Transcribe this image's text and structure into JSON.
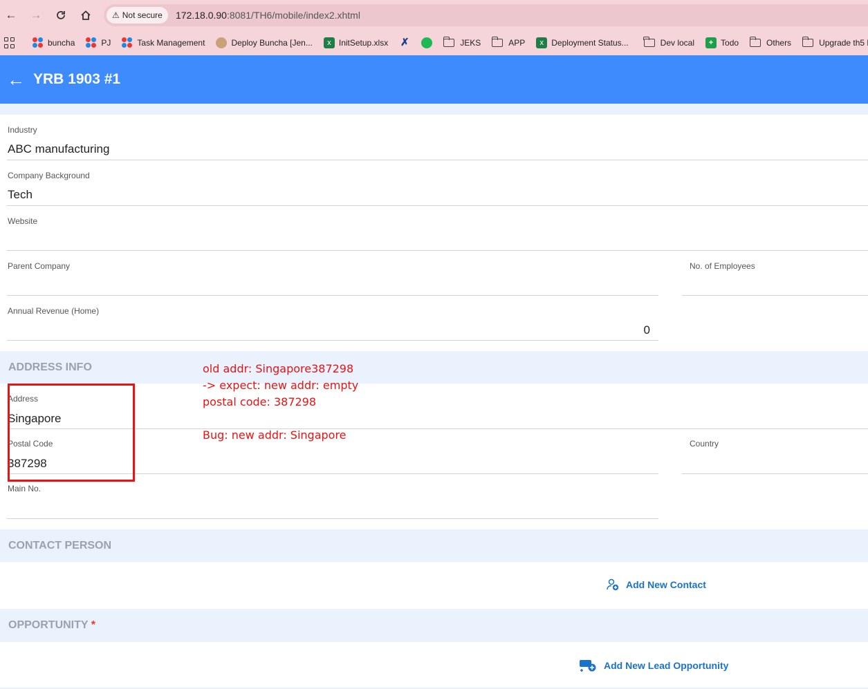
{
  "browser": {
    "security_label": "Not secure",
    "url_host": "172.18.0.90",
    "url_rest": ":8081/TH6/mobile/index2.xhtml",
    "bookmarks": [
      "buncha",
      "PJ",
      "Task Management",
      "Deploy Buncha [Jen...",
      "InitSetup.xlsx",
      "JEKS",
      "APP",
      "Deployment Status...",
      "Dev local",
      "Todo",
      "Others",
      "Upgrade th5 l"
    ]
  },
  "header": {
    "title": "YRB 1903 #1"
  },
  "company": {
    "industry_label": "Industry",
    "industry_value": "ABC manufacturing",
    "background_label": "Company Background",
    "background_value": "Tech",
    "website_label": "Website",
    "website_value": "",
    "parent_label": "Parent Company",
    "parent_value": "",
    "employees_label": "No. of Employees",
    "employees_value": "",
    "revenue_label": "Annual Revenue (Home)",
    "revenue_value": "0"
  },
  "address": {
    "section_title": "ADDRESS INFO",
    "address_label": "Address",
    "address_value": "Singapore",
    "postal_label": "Postal Code",
    "postal_value": "387298",
    "country_label": "Country",
    "country_value": "",
    "main_no_label": "Main No.",
    "main_no_value": ""
  },
  "annotation": {
    "line1": "old addr: Singapore387298",
    "line2": "-> expect: new addr: empty",
    "line3": "postal code: 387298",
    "line4": "Bug: new addr: Singapore"
  },
  "contact": {
    "section_title": "CONTACT PERSON",
    "add_label": "Add New Contact"
  },
  "opportunity": {
    "section_title": "OPPORTUNITY",
    "required_mark": "*",
    "add_label": "Add New Lead Opportunity"
  },
  "colors": {
    "header": "#3d8bfd",
    "annotation": "#ee1111",
    "link": "#1a73c9"
  }
}
